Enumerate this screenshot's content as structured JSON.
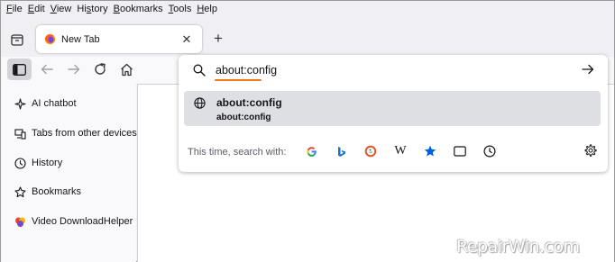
{
  "menu": [
    {
      "id": "file",
      "label": "File",
      "accel": "F"
    },
    {
      "id": "edit",
      "label": "Edit",
      "accel": "E"
    },
    {
      "id": "view",
      "label": "View",
      "accel": "V"
    },
    {
      "id": "history",
      "label": "History",
      "accel": "s"
    },
    {
      "id": "bookmarks",
      "label": "Bookmarks",
      "accel": "B"
    },
    {
      "id": "tools",
      "label": "Tools",
      "accel": "T"
    },
    {
      "id": "help",
      "label": "Help",
      "accel": "H"
    }
  ],
  "tab": {
    "title": "New Tab",
    "close_glyph": "✕",
    "new_tab_glyph": "+"
  },
  "urlbar": {
    "value": "about:config",
    "go_icon": "arrow-right-icon",
    "accent_color": "#f07818"
  },
  "results": [
    {
      "title": "about:config",
      "url": "about:config",
      "icon": "globe-icon"
    }
  ],
  "search_with": {
    "label": "This time, search with:",
    "engines": [
      {
        "id": "google",
        "icon": "google-icon"
      },
      {
        "id": "bing",
        "icon": "bing-icon"
      },
      {
        "id": "duckduckgo",
        "icon": "duckduckgo-icon"
      },
      {
        "id": "wikipedia",
        "icon": "wikipedia-icon",
        "glyph": "W"
      },
      {
        "id": "bookmarks",
        "icon": "star-icon"
      },
      {
        "id": "tabs",
        "icon": "tabs-icon"
      },
      {
        "id": "history",
        "icon": "clock-icon"
      }
    ]
  },
  "sidebar": {
    "items": [
      {
        "label": "AI chatbot",
        "icon": "sparkle-icon"
      },
      {
        "label": "Tabs from other devices",
        "icon": "synced-tabs-icon"
      },
      {
        "label": "History",
        "icon": "clock-icon"
      },
      {
        "label": "Bookmarks",
        "icon": "star-outline-icon"
      },
      {
        "label": "Video DownloadHelper",
        "icon": "video-downloadhelper-icon"
      }
    ]
  },
  "watermark": "RepairWin.com",
  "colors": {
    "toolbar_bg": "#f0f0f4",
    "selected_row": "#dedfe3",
    "sidebar_toggle_active": "#d4d4d8",
    "star_blue": "#0060df"
  }
}
